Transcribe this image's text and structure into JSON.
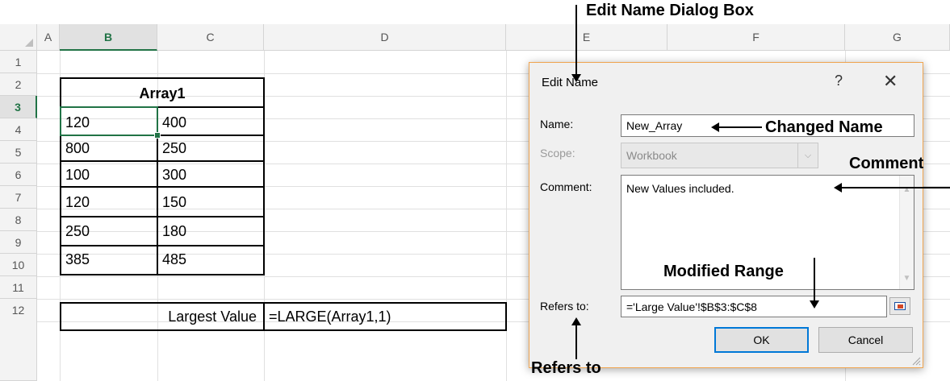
{
  "spreadsheet": {
    "columns": [
      "A",
      "B",
      "C",
      "D",
      "E",
      "F",
      "G"
    ],
    "rows": [
      "1",
      "2",
      "3",
      "4",
      "5",
      "6",
      "7",
      "8",
      "9",
      "10",
      "11",
      "12"
    ],
    "table_title": "Array1",
    "data": [
      [
        "120",
        "400"
      ],
      [
        "800",
        "250"
      ],
      [
        "100",
        "300"
      ],
      [
        "120",
        "150"
      ],
      [
        "250",
        "180"
      ],
      [
        "385",
        "485"
      ]
    ],
    "result_label": "Largest Value",
    "result_formula": "=LARGE(Array1,1)"
  },
  "dialog": {
    "title": "Edit Name",
    "help": "?",
    "close": "✕",
    "name_label": "Name:",
    "name_value": "New_Array",
    "scope_label": "Scope:",
    "scope_value": "Workbook",
    "comment_label": "Comment:",
    "comment_value": "New Values included.",
    "refers_label": "Refers to:",
    "refers_value": "='Large Value'!$B$3:$C$8",
    "ok": "OK",
    "cancel": "Cancel"
  },
  "annotations": {
    "dialog_box": "Edit Name Dialog Box",
    "changed_name": "Changed Name",
    "comment": "Comment",
    "modified_range": "Modified Range",
    "refers_to": "Refers to"
  },
  "icons": {
    "close": "close-icon",
    "help": "help-icon",
    "dropdown": "chevron-down-icon",
    "collapse": "collapse-dialog-icon"
  },
  "colors": {
    "accent": "#217346",
    "dialog_border": "#f0a550",
    "ok_border": "#0078d7"
  }
}
